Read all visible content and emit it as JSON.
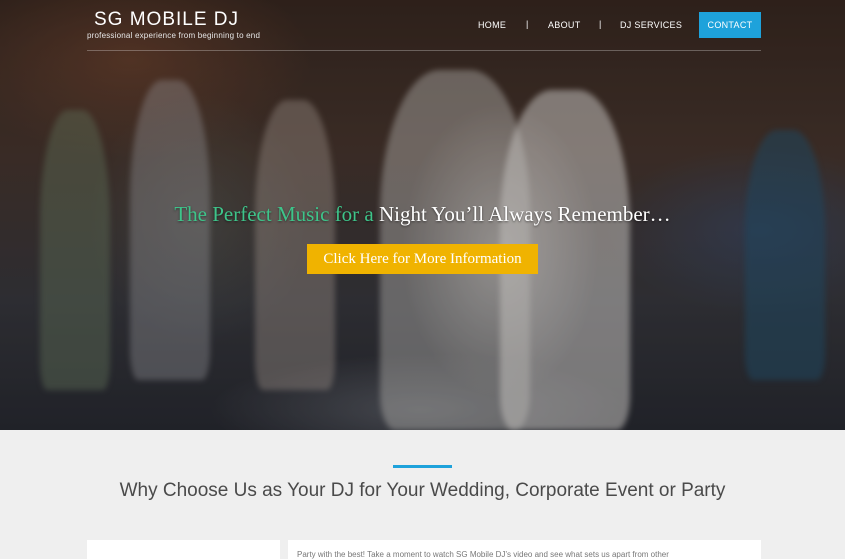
{
  "brand": {
    "title": "SG MOBILE DJ",
    "tagline": "professional experience from beginning to end"
  },
  "nav": {
    "items": [
      "HOME",
      "ABOUT",
      "DJ SERVICES"
    ],
    "separator": "|",
    "contact": "CONTACT"
  },
  "hero": {
    "headline_part1": "The Perfect Music for a",
    "headline_part2": "Night You’ll Always Remember…",
    "cta": "Click Here for More Information"
  },
  "section": {
    "title": "Why Choose Us as Your DJ for Your Wedding, Corporate Event or Party",
    "intro": "Party with the best! Take a moment to watch SG Mobile DJ’s video and see what sets us apart from other"
  },
  "colors": {
    "accent_blue": "#1ea2db",
    "cta_yellow": "#f0b300",
    "headline_green": "#3ec48a"
  }
}
